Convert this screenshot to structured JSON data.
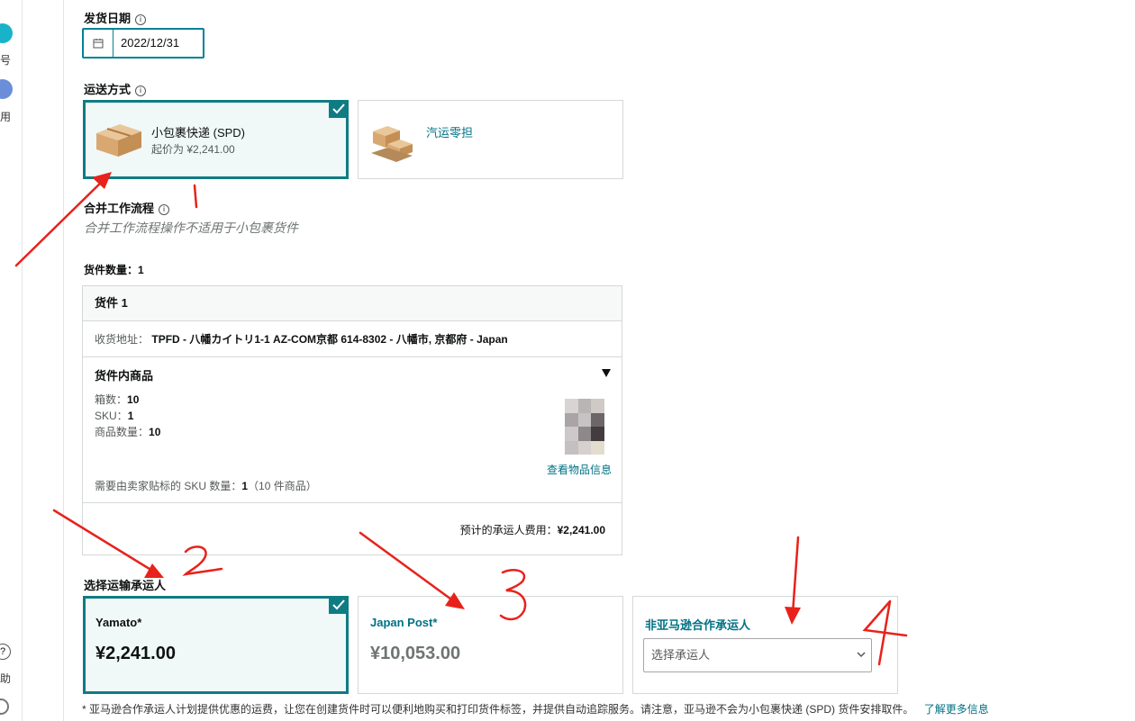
{
  "sidebar": {
    "item1_label": "号",
    "item2_label": "用",
    "help_label": "助",
    "help_icon_glyph": "?"
  },
  "ship_date": {
    "label": "发货日期",
    "value": "2022/12/31"
  },
  "shipping_method": {
    "label": "运送方式",
    "options": [
      {
        "title": "小包裹快递 (SPD)",
        "subtitle": "起价为 ¥2,241.00",
        "selected": true
      },
      {
        "title": "汽运零担",
        "subtitle": "",
        "selected": false
      }
    ]
  },
  "workflow": {
    "label": "合并工作流程",
    "note": "合并工作流程操作不适用于小包裹货件"
  },
  "shipments": {
    "count_label": "货件数量：",
    "count": "1",
    "title": "货件 1",
    "address_label": "收货地址：",
    "address_value": "TPFD - 八幡カイトリ1-1 AZ-COM京都 614-8302 - 八幡市, 京都府 - Japan",
    "contents_label": "货件内商品",
    "boxes_label": "箱数：",
    "boxes_value": "10",
    "sku_label": "SKU：",
    "sku_value": "1",
    "units_label": "商品数量：",
    "units_value": "10",
    "view_items_link": "查看物品信息",
    "labeling_label": "需要由卖家贴标的 SKU 数量：",
    "labeling_value": "1",
    "labeling_suffix": "（10 件商品）",
    "estimate_label": "预计的承运人费用：",
    "estimate_value": "¥2,241.00"
  },
  "carrier": {
    "label": "选择运输承运人",
    "options": [
      {
        "name": "Yamato*",
        "price": "¥2,241.00",
        "selected": true
      },
      {
        "name": "Japan Post*",
        "price": "¥10,053.00",
        "selected": false
      }
    ],
    "non_partner_title": "非亚马逊合作承运人",
    "select_placeholder": "选择承运人"
  },
  "footnote": {
    "text": "* 亚马逊合作承运人计划提供优惠的运费，让您在创建货件时可以便利地购买和打印货件标签，并提供自动追踪服务。请注意，亚马逊不会为小包裹快递 (SPD) 货件安排取件。",
    "link": "了解更多信息"
  },
  "annotations": {
    "marks": [
      "1",
      "2",
      "3",
      "4"
    ],
    "color": "#e8221b"
  },
  "colors": {
    "accent": "#0f7c83",
    "link": "#007185",
    "annotation": "#e8221b"
  }
}
